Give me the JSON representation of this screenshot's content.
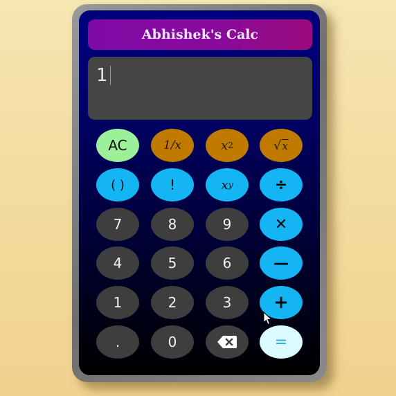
{
  "app": {
    "title": "Abhishek's Calc"
  },
  "display": {
    "value": "1"
  },
  "keys": {
    "ac": "AC",
    "reciprocal": "1/x",
    "square_base": "x",
    "square_exp": "2",
    "sqrt_radical": "√",
    "sqrt_arg": "x",
    "paren": "( )",
    "factorial": "!",
    "power_base": "x",
    "power_exp": "y",
    "divide": "÷",
    "seven": "7",
    "eight": "8",
    "nine": "9",
    "multiply": "✕",
    "four": "4",
    "five": "5",
    "six": "6",
    "subtract": "—",
    "one": "1",
    "two": "2",
    "three": "3",
    "add": "+",
    "dot": ".",
    "zero": "0",
    "equals": "="
  },
  "colors": {
    "title_bar": "#8a0b9a",
    "display_bg": "#454545",
    "number_key": "#3e3e3e",
    "operator_key": "#13b6f2",
    "function_key": "#c07a00",
    "clear_key": "#9cf09a",
    "equals_key": "#dcfbff",
    "background": "#f3d99b"
  },
  "icons": {
    "backspace": "backspace-icon",
    "pointer": "mouse-pointer-icon"
  }
}
